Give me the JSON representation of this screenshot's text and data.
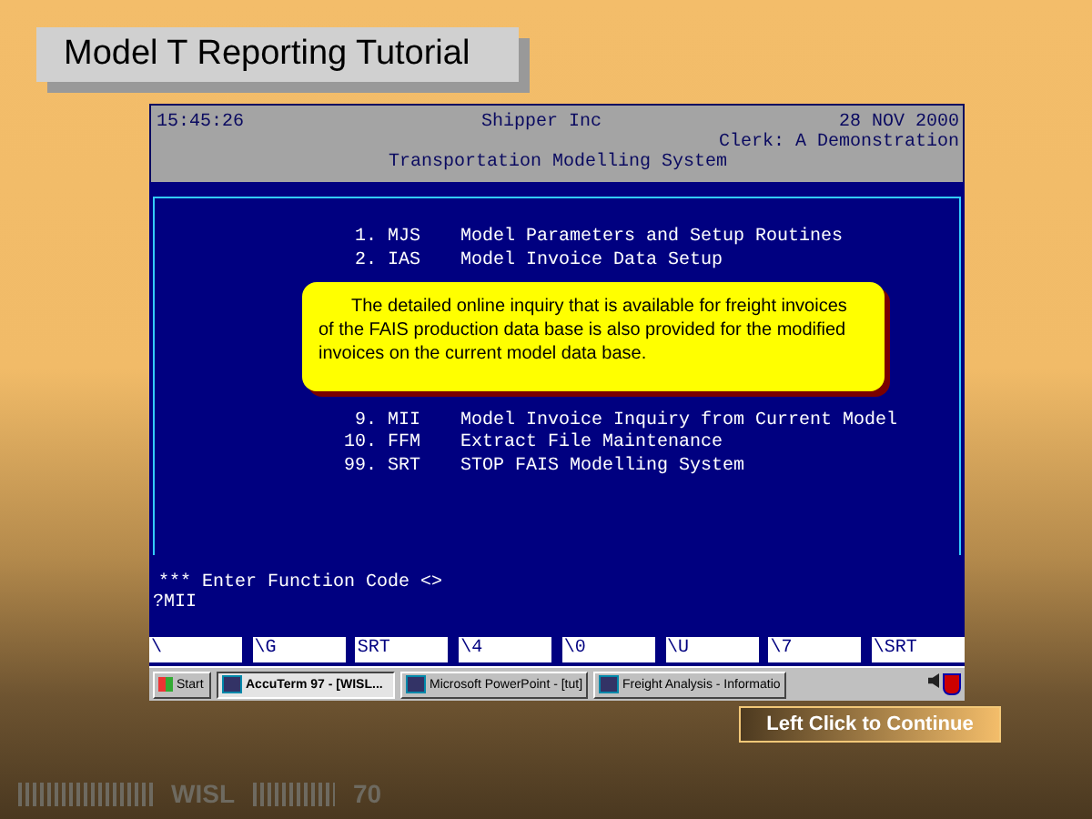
{
  "slide": {
    "title": "Model T Reporting Tutorial",
    "continue_button": "Left Click to Continue",
    "footer": {
      "org": "WISL",
      "page": "70"
    }
  },
  "terminal": {
    "time": "15:45:26",
    "company": "Shipper Inc",
    "date": "28 NOV 2000",
    "clerk": "Clerk: A Demonstration",
    "system": "Transportation Modelling System",
    "menu": [
      {
        "number": "1.",
        "code": "MJS",
        "label": "Model Parameters and Setup Routines"
      },
      {
        "number": "2.",
        "code": "IAS",
        "label": "Model Invoice Data Setup"
      },
      {
        "number": "9.",
        "code": "MII",
        "label": "Model Invoice Inquiry from Current Model"
      },
      {
        "number": "10.",
        "code": "FFM",
        "label": "Extract File Maintenance"
      },
      {
        "number": "99.",
        "code": "SRT",
        "label": "STOP FAIS Modelling System"
      }
    ],
    "prompt": "*** Enter Function Code <>",
    "input": "?MII",
    "function_keys": [
      "\\",
      "\\G",
      "SRT",
      "\\4",
      "\\0",
      "\\U",
      "\\7",
      "\\SRT"
    ],
    "callout": "The detailed online inquiry that is available for freight invoices of the FAIS production data base is also provided for the modified invoices on the current model data base."
  },
  "taskbar": {
    "start": "Start",
    "tasks": [
      {
        "label": "AccuTerm 97 - [WISL...",
        "selected": true
      },
      {
        "label": "Microsoft PowerPoint - [tut]",
        "selected": false
      },
      {
        "label": "Freight Analysis - Informatio",
        "selected": false
      }
    ]
  }
}
